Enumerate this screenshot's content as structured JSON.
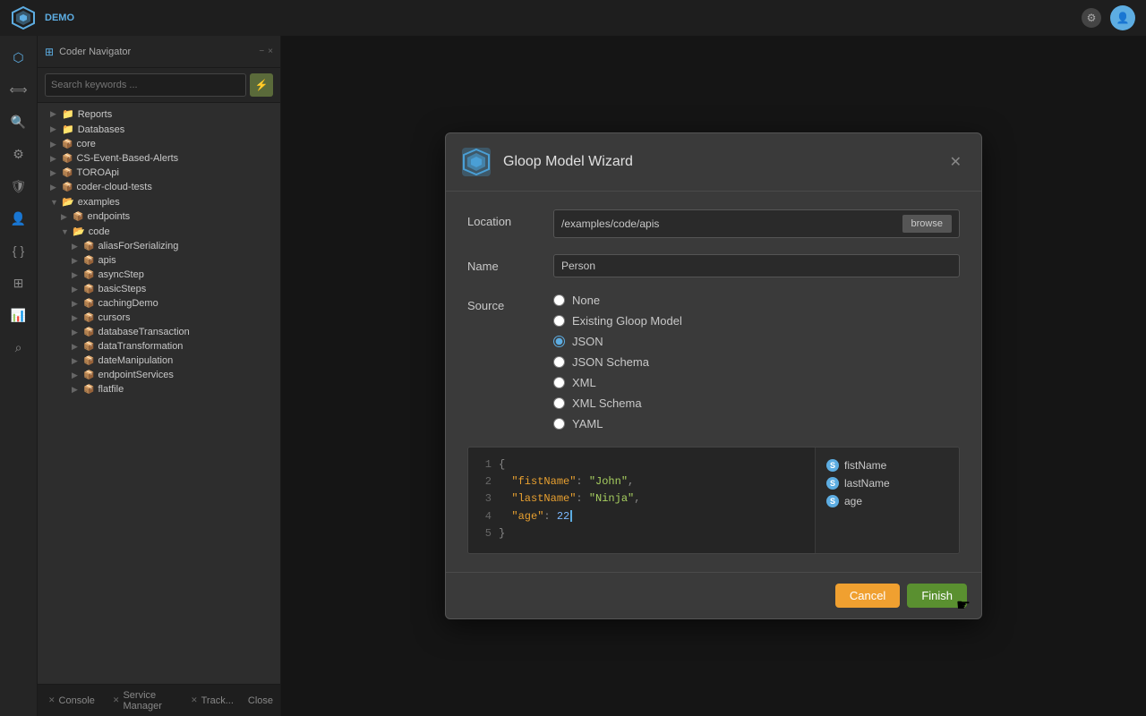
{
  "app": {
    "title": "DEMO",
    "top_icons": [
      "settings-icon",
      "user-icon"
    ]
  },
  "panel": {
    "title": "Coder Navigator",
    "search_placeholder": "Search keywords ...",
    "close_label": "×",
    "minimize_label": "−"
  },
  "tree": {
    "items": [
      {
        "label": "Reports",
        "type": "folder",
        "indent": 1,
        "expanded": false
      },
      {
        "label": "Databases",
        "type": "folder",
        "indent": 1,
        "expanded": false
      },
      {
        "label": "core",
        "type": "package",
        "indent": 1,
        "expanded": false
      },
      {
        "label": "CS-Event-Based-Alerts",
        "type": "package",
        "indent": 1,
        "expanded": false
      },
      {
        "label": "TOROApi",
        "type": "package",
        "indent": 1,
        "expanded": false
      },
      {
        "label": "coder-cloud-tests",
        "type": "package",
        "indent": 1,
        "expanded": false
      },
      {
        "label": "examples",
        "type": "folder",
        "indent": 1,
        "expanded": true
      },
      {
        "label": "endpoints",
        "type": "package",
        "indent": 2,
        "expanded": false
      },
      {
        "label": "code",
        "type": "folder",
        "indent": 2,
        "expanded": true
      },
      {
        "label": "aliasForSerializing",
        "type": "package",
        "indent": 3,
        "expanded": false
      },
      {
        "label": "apis",
        "type": "package",
        "indent": 3,
        "expanded": false
      },
      {
        "label": "asyncStep",
        "type": "package",
        "indent": 3,
        "expanded": false
      },
      {
        "label": "basicSteps",
        "type": "package",
        "indent": 3,
        "expanded": false
      },
      {
        "label": "cachingDemo",
        "type": "package",
        "indent": 3,
        "expanded": false
      },
      {
        "label": "cursors",
        "type": "package",
        "indent": 3,
        "expanded": false
      },
      {
        "label": "databaseTransaction",
        "type": "package",
        "indent": 3,
        "expanded": false
      },
      {
        "label": "dataTransformation",
        "type": "package",
        "indent": 3,
        "expanded": false
      },
      {
        "label": "dateManipulation",
        "type": "package",
        "indent": 3,
        "expanded": false
      },
      {
        "label": "endpointServices",
        "type": "package",
        "indent": 3,
        "expanded": false
      },
      {
        "label": "flatfile",
        "type": "package",
        "indent": 3,
        "expanded": false
      }
    ]
  },
  "bottom_tabs": [
    {
      "label": "Console"
    },
    {
      "label": "Service Manager"
    },
    {
      "label": "Track..."
    }
  ],
  "bottom_close": "Close",
  "dialog": {
    "title": "Gloop Model Wizard",
    "location_label": "Location",
    "location_value": "/examples/code/apis",
    "browse_label": "browse",
    "name_label": "Name",
    "name_value": "Person",
    "source_label": "Source",
    "source_options": [
      {
        "label": "None",
        "value": "none"
      },
      {
        "label": "Existing Gloop Model",
        "value": "existing"
      },
      {
        "label": "JSON",
        "value": "json",
        "selected": true
      },
      {
        "label": "JSON Schema",
        "value": "json_schema"
      },
      {
        "label": "XML",
        "value": "xml"
      },
      {
        "label": "XML Schema",
        "value": "xml_schema"
      },
      {
        "label": "YAML",
        "value": "yaml"
      }
    ],
    "json_lines": [
      {
        "num": 1,
        "content": "{"
      },
      {
        "num": 2,
        "key": "\"fistName\"",
        "colon": ": ",
        "val": "\"John\"",
        "comma": ","
      },
      {
        "num": 3,
        "key": "\"lastName\"",
        "colon": ": ",
        "val": "\"Ninja\"",
        "comma": ","
      },
      {
        "num": 4,
        "key": "\"age\"",
        "colon": ": ",
        "val": "22"
      },
      {
        "num": 5,
        "content": "}"
      }
    ],
    "model_fields": [
      {
        "name": "fistName",
        "icon": "S"
      },
      {
        "name": "lastName",
        "icon": "S"
      },
      {
        "name": "age",
        "icon": "S"
      }
    ],
    "cancel_label": "Cancel",
    "finish_label": "Finish",
    "close_label": "✕"
  }
}
